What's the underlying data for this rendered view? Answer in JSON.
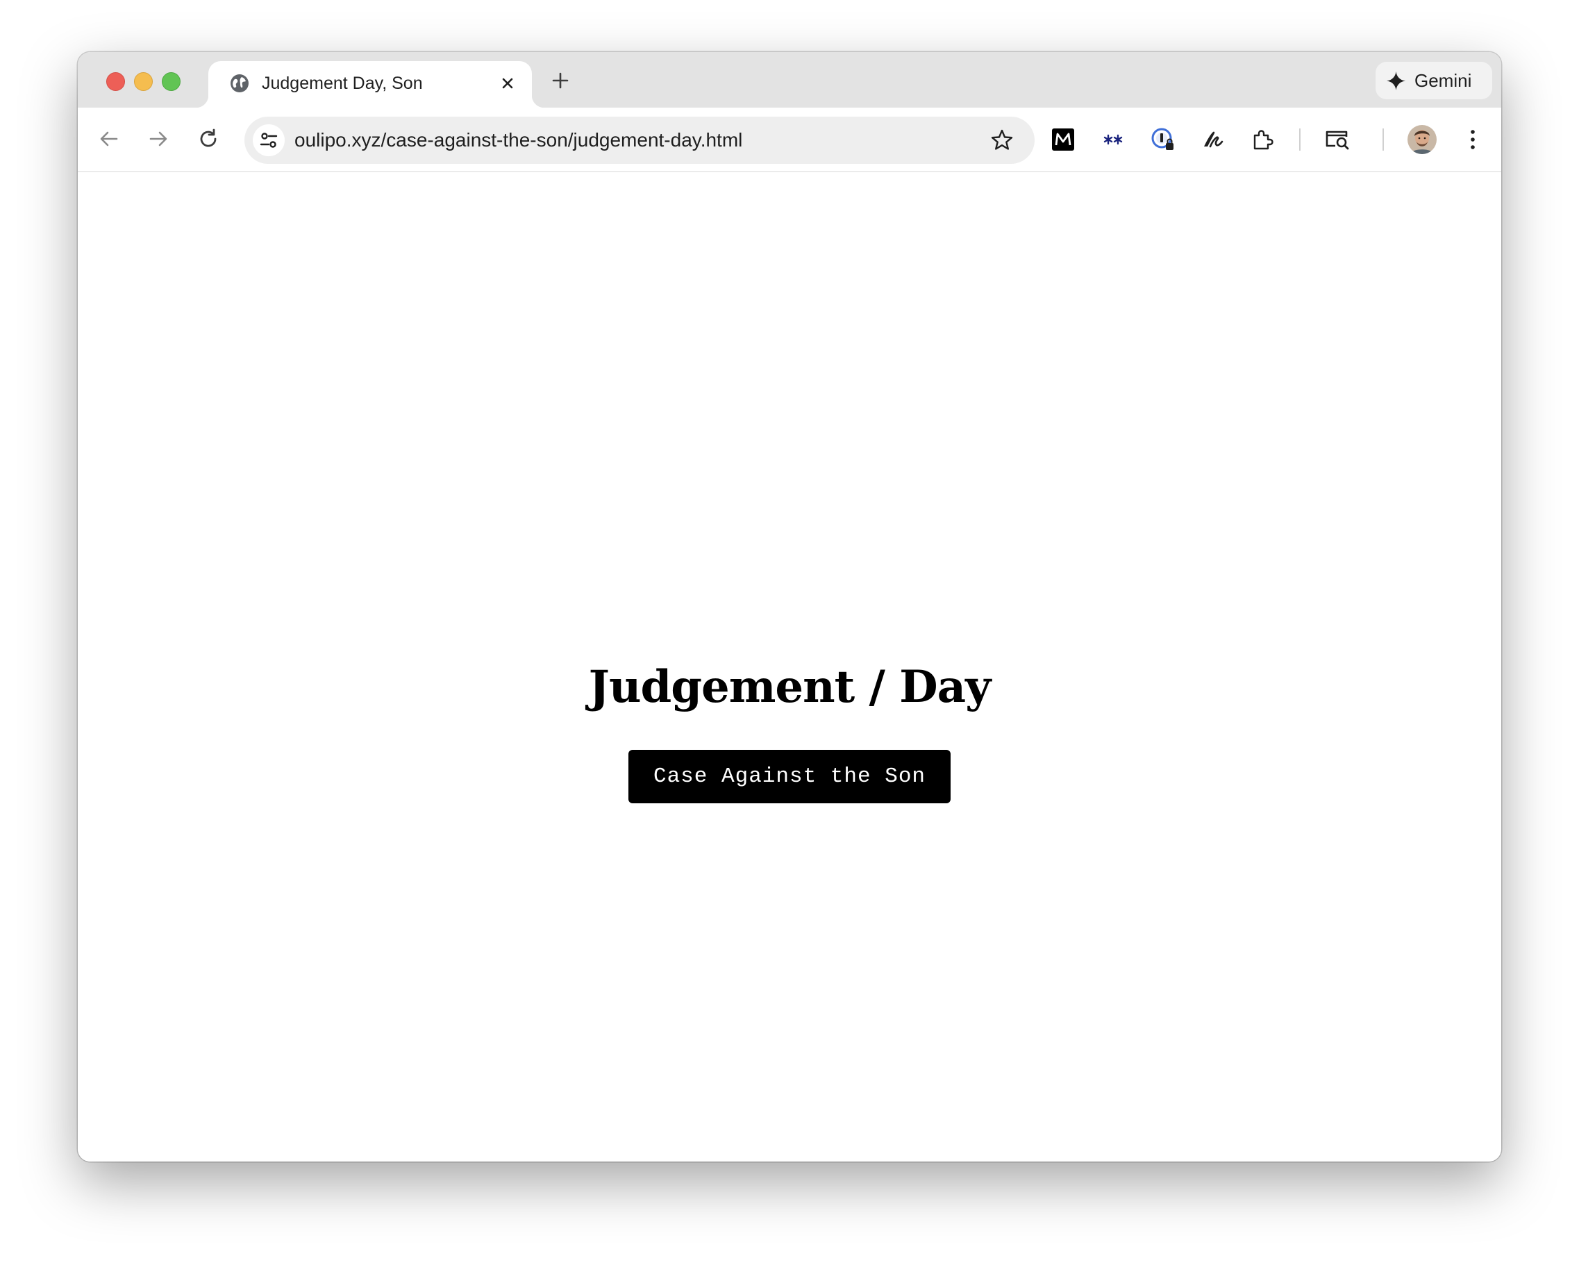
{
  "tab": {
    "title": "Judgement Day, Son",
    "favicon": "globe-icon"
  },
  "tabstrip": {
    "gemini_label": "Gemini"
  },
  "toolbar": {
    "url": "oulipo.xyz/case-against-the-son/judgement-day.html",
    "extensions": [
      "medium-icon",
      "asterisks-icon",
      "password-manager-icon",
      "script-icon",
      "puzzle-extensions-icon",
      "tab-search-icon"
    ]
  },
  "page": {
    "title": "Judgement / Day",
    "button_label": "Case Against the Son"
  },
  "colors": {
    "tabstrip_bg": "#e3e3e3",
    "omnibox_bg": "#eeeeee",
    "button_bg": "#000000",
    "button_text": "#ffffff",
    "traffic_red": "#ed5f57",
    "traffic_yellow": "#f5bd4f",
    "traffic_green": "#61c454"
  }
}
